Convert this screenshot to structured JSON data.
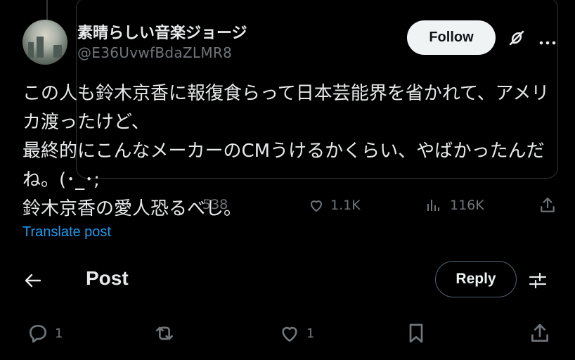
{
  "author": {
    "display_name": "素晴らしい音楽ジョージ",
    "handle": "@E36UvwfBdaZLMR8"
  },
  "follow_label": "Follow",
  "tweet": {
    "text": "この人も鈴木京香に報復食らって日本芸能界を省かれて、アメリカ渡ったけど、\n最終的にこんなメーカーのCMうけるかくらい、やばかったんだね。(･_･;\n鈴木京香の愛人恐るべし。"
  },
  "translate_label": "Translate post",
  "underlying_stats": {
    "reposts": "538",
    "likes": "1.1K",
    "views": "116K"
  },
  "header": {
    "title": "Post",
    "reply_label": "Reply"
  },
  "actions": {
    "replies": "1",
    "likes": "1"
  },
  "icons": [
    "back-arrow-icon",
    "grok-icon",
    "more-icon",
    "sliders-icon",
    "reply-icon",
    "repost-icon",
    "like-icon",
    "bookmark-icon",
    "share-icon",
    "views-icon"
  ]
}
